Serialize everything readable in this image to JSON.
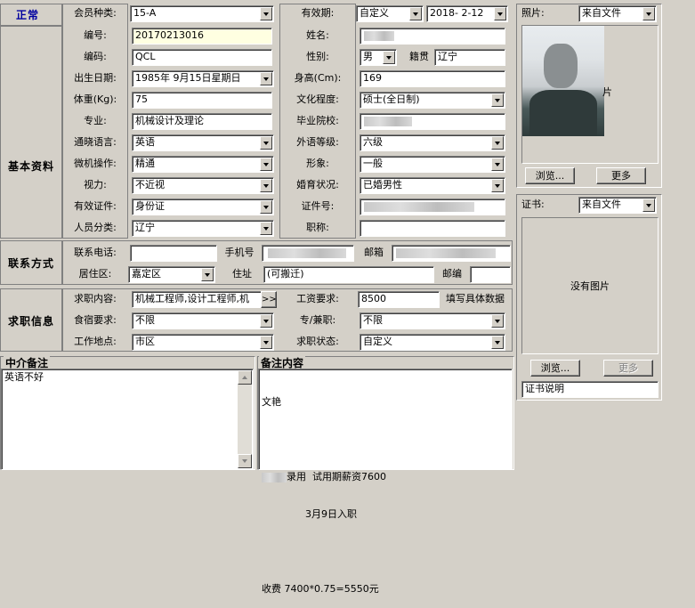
{
  "status": "正常",
  "sections": {
    "basic": "基本资料",
    "contact": "联系方式",
    "job": "求职信息"
  },
  "labels": {
    "member_type": "会员种类:",
    "validity": "有效期:",
    "number": "编号:",
    "name": "姓名:",
    "code": "编码:",
    "gender": "性别:",
    "native": "籍贯",
    "birth": "出生日期:",
    "height": "身高(Cm):",
    "weight": "体重(Kg):",
    "education": "文化程度:",
    "major": "专业:",
    "school": "毕业院校:",
    "language": "通晓语言:",
    "lang_level": "外语等级:",
    "computer": "微机操作:",
    "image": "形象:",
    "vision": "视力:",
    "marital": "婚育状况:",
    "id_type": "有效证件:",
    "id_no": "证件号:",
    "category": "人员分类:",
    "title": "职称:",
    "phone": "联系电话:",
    "mobile": "手机号",
    "email": "邮箱",
    "district": "居住区:",
    "address": "住址",
    "zip": "邮编",
    "job_content": "求职内容:",
    "salary": "工资要求:",
    "salary_note": "填写具体数据",
    "lodging": "食宿要求:",
    "fulltime": "专/兼职:",
    "location": "工作地点:",
    "job_status": "求职状态:",
    "agent_note": "中介备注",
    "remark": "备注内容",
    "photo": "照片:",
    "certificate": "证书:"
  },
  "values": {
    "member_type": "15-A",
    "validity_type": "自定义",
    "validity_date": "2018- 2-12",
    "number": "20170213016",
    "code": "QCL",
    "gender": "男",
    "native": "辽宁",
    "birth": "1985年 9月15日星期日",
    "height": "169",
    "weight": "75",
    "education": "硕士(全日制)",
    "major": "机械设计及理论",
    "language": "英语",
    "lang_level": "六级",
    "computer": "精通",
    "image": "一般",
    "vision": "不近视",
    "marital": "已婚男性",
    "id_type": "身份证",
    "category": "辽宁",
    "district": "嘉定区",
    "address": "(可搬迁)",
    "job_content": "机械工程师,设计工程师,机",
    "job_more": ">>",
    "salary": "8500",
    "lodging": "不限",
    "fulltime": "不限",
    "location": "市区",
    "job_status": "自定义",
    "agent_note": "英语不好",
    "remark_lines": [
      "文艳",
      "",
      "录用  试用期薪资7600",
      "              3月9日入职",
      "",
      "收费 7400*0.75=5550元"
    ]
  },
  "photo": {
    "source": "来自文件",
    "browse": "浏览...",
    "more": "更多",
    "partial_text": "片"
  },
  "certificate": {
    "source": "来自文件",
    "no_image": "没有图片",
    "browse": "浏览...",
    "more": "更多",
    "caption": "证书说明"
  }
}
